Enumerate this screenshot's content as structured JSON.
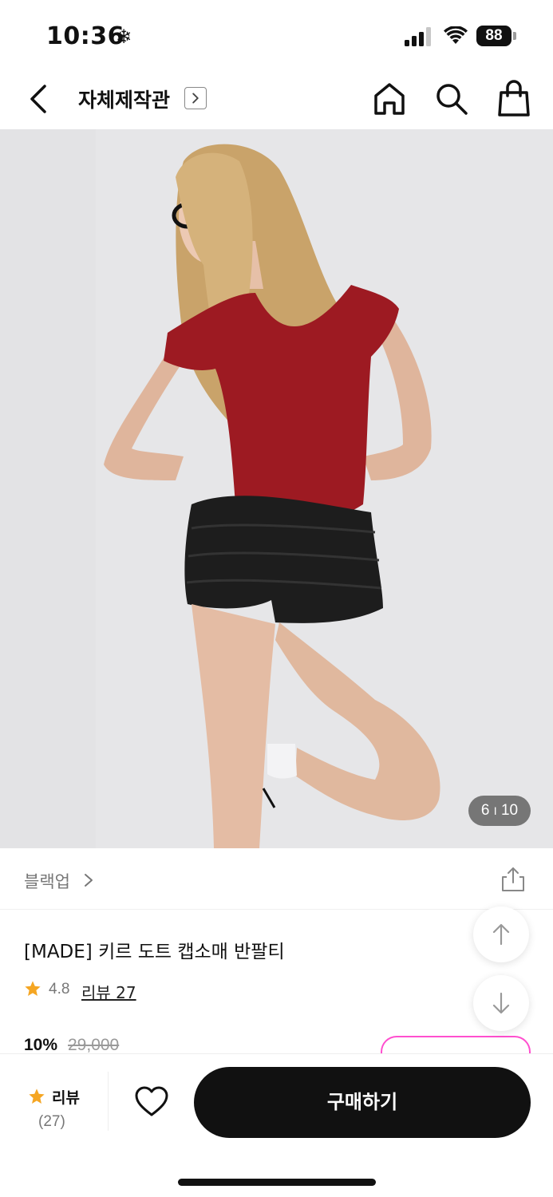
{
  "status_bar": {
    "time": "10:36",
    "extra_icon": "❄",
    "battery": "88"
  },
  "nav": {
    "title": "자체제작관",
    "icons": [
      "back-arrow-icon",
      "chevron-right-icon",
      "home-icon",
      "search-icon",
      "shopping-bag-icon"
    ]
  },
  "gallery": {
    "current": "6",
    "separator": "I",
    "total": "10"
  },
  "category": {
    "label": "블랙업"
  },
  "product": {
    "title": "[MADE] 키르 도트 캡소매 반팔티",
    "rating": "4.8",
    "review_link": "리뷰 27",
    "discount": "10%",
    "original_price": "29,000"
  },
  "bottom_bar": {
    "review_label": "리뷰",
    "review_count": "(27)",
    "buy_label": "구매하기"
  },
  "colors": {
    "accent_star": "#f5a623",
    "buy_button": "#111111",
    "coupon_outline": "#ff4fcf"
  }
}
